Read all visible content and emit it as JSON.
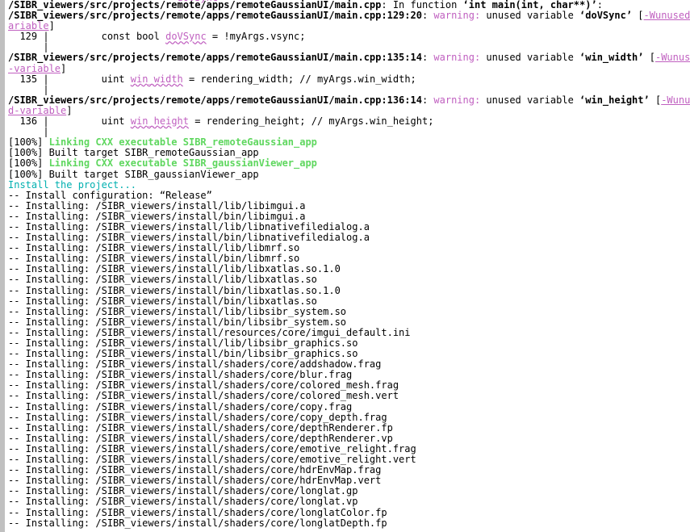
{
  "terminal": {
    "kind": "build-console",
    "background_color": "#ffffff",
    "foreground_color": "#000000",
    "font_size_px": 12,
    "line_height_px": 13.1,
    "scrollbar": {
      "name": "vertical-scrollbar",
      "side": "left",
      "track_color": "#f0f0f0",
      "thumb_color": "#c0c0c0",
      "thumb_top_pct": 0,
      "thumb_height_pct": 100
    },
    "colors": {
      "warning": "#c060c0",
      "flag": "#c060c0",
      "variable": "#c060c0",
      "linking": "#5fd75f",
      "install_header": "#00b0b0",
      "plain": "#000000"
    }
  },
  "clipped_top_line": "                             doVSync",
  "lines": [
    {
      "id": "l01",
      "type": "diag-context",
      "segments": [
        {
          "text": "/SIBR_viewers/src/projects/remote/apps/remoteGaussianUI/main.cpp",
          "style": "path"
        },
        {
          "text": ": In function ",
          "style": "plain"
        },
        {
          "text": "‘int main(int, char**)’",
          "style": "b"
        },
        {
          "text": ":",
          "style": "plain"
        }
      ]
    },
    {
      "id": "l02",
      "type": "diag-warning",
      "segments": [
        {
          "text": "/SIBR_viewers/src/projects/remote/apps/remoteGaussianUI/main.cpp:129:20",
          "style": "path"
        },
        {
          "text": ": ",
          "style": "plain"
        },
        {
          "text": "warning:",
          "style": "warn"
        },
        {
          "text": " unused variable ",
          "style": "plain"
        },
        {
          "text": "‘doVSync’",
          "style": "b"
        },
        {
          "text": " [",
          "style": "plain"
        },
        {
          "text": "-Wunused-v",
          "style": "flag"
        }
      ]
    },
    {
      "id": "l03",
      "type": "diag-warning-wrap",
      "segments": [
        {
          "text": "ariable",
          "style": "flag"
        },
        {
          "text": "]",
          "style": "plain"
        }
      ]
    },
    {
      "id": "l04",
      "type": "source-line",
      "segments": [
        {
          "text": "  129 ",
          "style": "gutter"
        },
        {
          "text": "|",
          "style": "pipe"
        },
        {
          "text": "         const bool ",
          "style": "plain"
        },
        {
          "text": "doVSync",
          "style": "var"
        },
        {
          "text": " = !myArgs.vsync;",
          "style": "plain"
        }
      ]
    },
    {
      "id": "l05",
      "type": "blank",
      "segments": [
        {
          "text": "      |",
          "style": "pipe"
        }
      ]
    },
    {
      "id": "l06",
      "type": "diag-warning",
      "segments": [
        {
          "text": "/SIBR_viewers/src/projects/remote/apps/remoteGaussianUI/main.cpp:135:14",
          "style": "path"
        },
        {
          "text": ": ",
          "style": "plain"
        },
        {
          "text": "warning:",
          "style": "warn"
        },
        {
          "text": " unused variable ",
          "style": "plain"
        },
        {
          "text": "‘win_width’",
          "style": "b"
        },
        {
          "text": " [",
          "style": "plain"
        },
        {
          "text": "-Wunused",
          "style": "flag"
        }
      ]
    },
    {
      "id": "l07",
      "type": "diag-warning-wrap",
      "segments": [
        {
          "text": "-variable",
          "style": "flag"
        },
        {
          "text": "]",
          "style": "plain"
        }
      ]
    },
    {
      "id": "l08",
      "type": "source-line",
      "segments": [
        {
          "text": "  135 ",
          "style": "gutter"
        },
        {
          "text": "|",
          "style": "pipe"
        },
        {
          "text": "         uint ",
          "style": "plain"
        },
        {
          "text": "win_width",
          "style": "var"
        },
        {
          "text": " = rendering_width; // myArgs.win_width;",
          "style": "plain"
        }
      ]
    },
    {
      "id": "l09",
      "type": "blank",
      "segments": [
        {
          "text": "      |",
          "style": "pipe"
        }
      ]
    },
    {
      "id": "l10",
      "type": "diag-warning",
      "segments": [
        {
          "text": "/SIBR_viewers/src/projects/remote/apps/remoteGaussianUI/main.cpp:136:14",
          "style": "path"
        },
        {
          "text": ": ",
          "style": "plain"
        },
        {
          "text": "warning:",
          "style": "warn"
        },
        {
          "text": " unused variable ",
          "style": "plain"
        },
        {
          "text": "‘win_height’",
          "style": "b"
        },
        {
          "text": " [",
          "style": "plain"
        },
        {
          "text": "-Wunuse",
          "style": "flag"
        }
      ]
    },
    {
      "id": "l11",
      "type": "diag-warning-wrap",
      "segments": [
        {
          "text": "d-variable",
          "style": "flag"
        },
        {
          "text": "]",
          "style": "plain"
        }
      ]
    },
    {
      "id": "l12",
      "type": "source-line",
      "segments": [
        {
          "text": "  136 ",
          "style": "gutter"
        },
        {
          "text": "|",
          "style": "pipe"
        },
        {
          "text": "         uint ",
          "style": "plain"
        },
        {
          "text": "win_height",
          "style": "var"
        },
        {
          "text": " = rendering_height; // myArgs.win_height;",
          "style": "plain"
        }
      ]
    },
    {
      "id": "l13",
      "type": "blank",
      "segments": [
        {
          "text": "      |",
          "style": "pipe"
        }
      ]
    },
    {
      "id": "l14",
      "type": "progress",
      "segments": [
        {
          "text": "[100%] ",
          "style": "plain"
        },
        {
          "text": "Linking CXX executable SIBR_remoteGaussian_app",
          "style": "green"
        }
      ]
    },
    {
      "id": "l15",
      "type": "progress",
      "segments": [
        {
          "text": "[100%] Built target SIBR_remoteGaussian_app",
          "style": "plain"
        }
      ]
    },
    {
      "id": "l16",
      "type": "progress",
      "segments": [
        {
          "text": "[100%] ",
          "style": "plain"
        },
        {
          "text": "Linking CXX executable SIBR_gaussianViewer_app",
          "style": "green"
        }
      ]
    },
    {
      "id": "l17",
      "type": "progress",
      "segments": [
        {
          "text": "[100%] Built target SIBR_gaussianViewer_app",
          "style": "plain"
        }
      ]
    },
    {
      "id": "l18",
      "type": "install-header",
      "segments": [
        {
          "text": "Install the project...",
          "style": "cyan"
        }
      ]
    },
    {
      "id": "l19",
      "type": "install-config",
      "segments": [
        {
          "text": "-- Install configuration: “Release”",
          "style": "plain"
        }
      ]
    },
    {
      "id": "i01",
      "type": "install",
      "segments": [
        {
          "text": "-- Installing: /SIBR_viewers/install/lib/libimgui.a",
          "style": "plain"
        }
      ]
    },
    {
      "id": "i02",
      "type": "install",
      "segments": [
        {
          "text": "-- Installing: /SIBR_viewers/install/bin/libimgui.a",
          "style": "plain"
        }
      ]
    },
    {
      "id": "i03",
      "type": "install",
      "segments": [
        {
          "text": "-- Installing: /SIBR_viewers/install/lib/libnativefiledialog.a",
          "style": "plain"
        }
      ]
    },
    {
      "id": "i04",
      "type": "install",
      "segments": [
        {
          "text": "-- Installing: /SIBR_viewers/install/bin/libnativefiledialog.a",
          "style": "plain"
        }
      ]
    },
    {
      "id": "i05",
      "type": "install",
      "segments": [
        {
          "text": "-- Installing: /SIBR_viewers/install/lib/libmrf.so",
          "style": "plain"
        }
      ]
    },
    {
      "id": "i06",
      "type": "install",
      "segments": [
        {
          "text": "-- Installing: /SIBR_viewers/install/bin/libmrf.so",
          "style": "plain"
        }
      ]
    },
    {
      "id": "i07",
      "type": "install",
      "segments": [
        {
          "text": "-- Installing: /SIBR_viewers/install/lib/libxatlas.so.1.0",
          "style": "plain"
        }
      ]
    },
    {
      "id": "i08",
      "type": "install",
      "segments": [
        {
          "text": "-- Installing: /SIBR_viewers/install/lib/libxatlas.so",
          "style": "plain"
        }
      ]
    },
    {
      "id": "i09",
      "type": "install",
      "segments": [
        {
          "text": "-- Installing: /SIBR_viewers/install/bin/libxatlas.so.1.0",
          "style": "plain"
        }
      ]
    },
    {
      "id": "i10",
      "type": "install",
      "segments": [
        {
          "text": "-- Installing: /SIBR_viewers/install/bin/libxatlas.so",
          "style": "plain"
        }
      ]
    },
    {
      "id": "i11",
      "type": "install",
      "segments": [
        {
          "text": "-- Installing: /SIBR_viewers/install/lib/libsibr_system.so",
          "style": "plain"
        }
      ]
    },
    {
      "id": "i12",
      "type": "install",
      "segments": [
        {
          "text": "-- Installing: /SIBR_viewers/install/bin/libsibr_system.so",
          "style": "plain"
        }
      ]
    },
    {
      "id": "i13",
      "type": "install",
      "segments": [
        {
          "text": "-- Installing: /SIBR_viewers/install/resources/core/imgui_default.ini",
          "style": "plain"
        }
      ]
    },
    {
      "id": "i14",
      "type": "install",
      "segments": [
        {
          "text": "-- Installing: /SIBR_viewers/install/lib/libsibr_graphics.so",
          "style": "plain"
        }
      ]
    },
    {
      "id": "i15",
      "type": "install",
      "segments": [
        {
          "text": "-- Installing: /SIBR_viewers/install/bin/libsibr_graphics.so",
          "style": "plain"
        }
      ]
    },
    {
      "id": "i16",
      "type": "install",
      "segments": [
        {
          "text": "-- Installing: /SIBR_viewers/install/shaders/core/addshadow.frag",
          "style": "plain"
        }
      ]
    },
    {
      "id": "i17",
      "type": "install",
      "segments": [
        {
          "text": "-- Installing: /SIBR_viewers/install/shaders/core/blur.frag",
          "style": "plain"
        }
      ]
    },
    {
      "id": "i18",
      "type": "install",
      "segments": [
        {
          "text": "-- Installing: /SIBR_viewers/install/shaders/core/colored_mesh.frag",
          "style": "plain"
        }
      ]
    },
    {
      "id": "i19",
      "type": "install",
      "segments": [
        {
          "text": "-- Installing: /SIBR_viewers/install/shaders/core/colored_mesh.vert",
          "style": "plain"
        }
      ]
    },
    {
      "id": "i20",
      "type": "install",
      "segments": [
        {
          "text": "-- Installing: /SIBR_viewers/install/shaders/core/copy.frag",
          "style": "plain"
        }
      ]
    },
    {
      "id": "i21",
      "type": "install",
      "segments": [
        {
          "text": "-- Installing: /SIBR_viewers/install/shaders/core/copy_depth.frag",
          "style": "plain"
        }
      ]
    },
    {
      "id": "i22",
      "type": "install",
      "segments": [
        {
          "text": "-- Installing: /SIBR_viewers/install/shaders/core/depthRenderer.fp",
          "style": "plain"
        }
      ]
    },
    {
      "id": "i23",
      "type": "install",
      "segments": [
        {
          "text": "-- Installing: /SIBR_viewers/install/shaders/core/depthRenderer.vp",
          "style": "plain"
        }
      ]
    },
    {
      "id": "i24",
      "type": "install",
      "segments": [
        {
          "text": "-- Installing: /SIBR_viewers/install/shaders/core/emotive_relight.frag",
          "style": "plain"
        }
      ]
    },
    {
      "id": "i25",
      "type": "install",
      "segments": [
        {
          "text": "-- Installing: /SIBR_viewers/install/shaders/core/emotive_relight.vert",
          "style": "plain"
        }
      ]
    },
    {
      "id": "i26",
      "type": "install",
      "segments": [
        {
          "text": "-- Installing: /SIBR_viewers/install/shaders/core/hdrEnvMap.frag",
          "style": "plain"
        }
      ]
    },
    {
      "id": "i27",
      "type": "install",
      "segments": [
        {
          "text": "-- Installing: /SIBR_viewers/install/shaders/core/hdrEnvMap.vert",
          "style": "plain"
        }
      ]
    },
    {
      "id": "i28",
      "type": "install",
      "segments": [
        {
          "text": "-- Installing: /SIBR_viewers/install/shaders/core/longlat.gp",
          "style": "plain"
        }
      ]
    },
    {
      "id": "i29",
      "type": "install",
      "segments": [
        {
          "text": "-- Installing: /SIBR_viewers/install/shaders/core/longlat.vp",
          "style": "plain"
        }
      ]
    },
    {
      "id": "i30",
      "type": "install",
      "segments": [
        {
          "text": "-- Installing: /SIBR_viewers/install/shaders/core/longlatColor.fp",
          "style": "plain"
        }
      ]
    },
    {
      "id": "i31",
      "type": "install-clipped",
      "segments": [
        {
          "text": "-- Installing: /SIBR_viewers/install/shaders/core/longlatDepth.fp",
          "style": "plain"
        }
      ]
    }
  ]
}
